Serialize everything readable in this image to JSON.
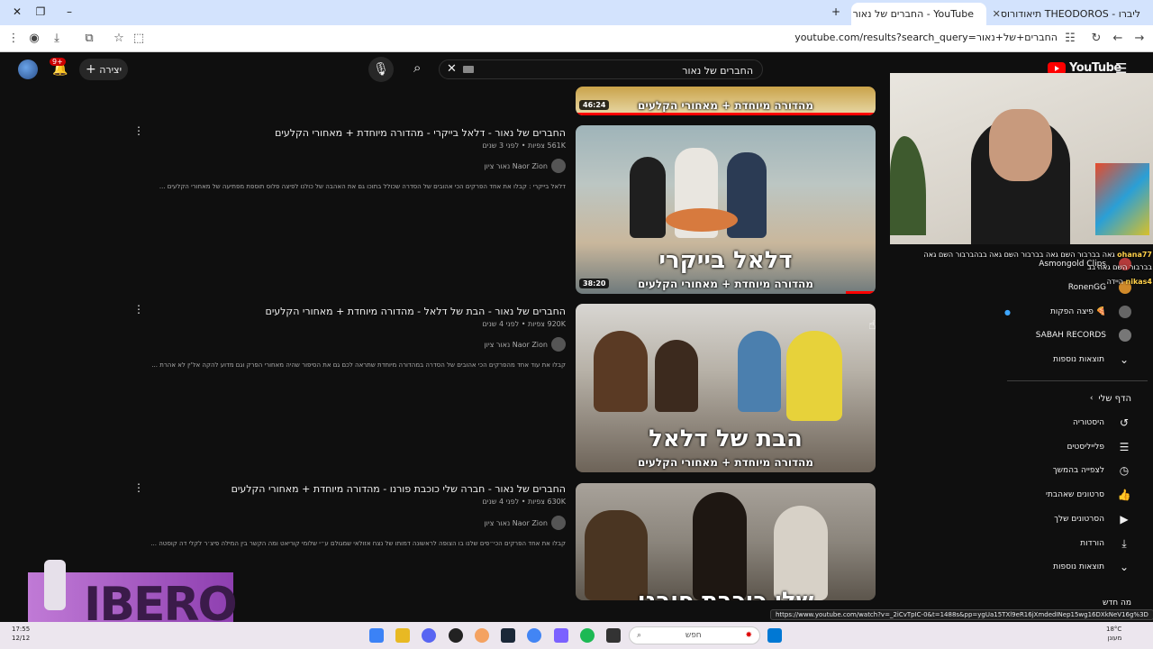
{
  "browser": {
    "tabs": [
      {
        "label": "YouTube - החברים של נאור (47)",
        "active": true
      },
      {
        "label": "ליברו - THEODOROS תיאודורוס",
        "active": false
      }
    ],
    "url": "youtube.com/results?search_query=החברים+של+נאור",
    "status_url": "https://www.youtube.com/watch?v=_2iCvTpIC-0&t=1488s&pp=ygUa15TXl9eR16jXmdedINep15wg16DXkNeV16g%3D"
  },
  "youtube": {
    "logo": "YouTube",
    "search_value": "החברים של נאור",
    "create_label": "יצירה",
    "notif_count": "9+",
    "results": [
      {
        "title": "החברים של נאור - דלאל בייקרי - מהדורה מיוחדת + מאחורי הקלעים",
        "meta": "561K צפיות • לפני 3 שנים",
        "channel": "נאור ציון Naor Zion",
        "desc": "דלאל בייקרי : קבלו את אחד הפרקים הכי אהובים של הסדרה שכולל בתוכו גם את האהבה של כולנו לפיצה פלוס תוספת מפתיעה של מאחורי הקלעים ...",
        "duration": "38:20",
        "thumb_big": "דלאל בייקרי",
        "thumb_small": "מהדורה מיוחדת + מאחורי הקלעים"
      },
      {
        "title": "החברים של נאור - הבת של דלאל - מהדורה מיוחדת + מאחורי הקלעים",
        "meta": "920K צפיות • לפני 4 שנים",
        "channel": "נאור ציון Naor Zion",
        "desc": "קבלו את עוד אחד מהפרקים הכי אהובים של הסדרה במהדורה מיוחדת שתראה לכם גם את הסיפור שהיה מאחורי הפרק וגם מדוע להקה אל'ין לא אהרת ...",
        "duration": "",
        "thumb_big": "הבת של דלאל",
        "thumb_small": "מהדורה מיוחדת + מאחורי הקלעים"
      },
      {
        "title": "החברים של נאור - חברה שלי כוכבת פורנו - מהדורה מיוחדת + מאחורי הקלעים",
        "meta": "630K צפיות • לפני 4 שנים",
        "channel": "נאור ציון Naor Zion",
        "desc": "קבלו את אחד הפרקים הכי״פים שלנו בו הצופה לראשונה דמותו של נצח אזולאי שמגולם ע״י שלומי קוריאט ומה הקשר בין המילה פיצ׳ר לקלי דה קוסטה ...",
        "duration": "",
        "thumb_big": "שלי כוכבת פורנו",
        "thumb_small": ""
      }
    ],
    "top_thumb": {
      "duration": "46:24",
      "small": "מהדורה מיוחדת + מאחורי הקלעים"
    },
    "sidebar": {
      "subs": [
        {
          "label": "Asmongold Clips",
          "color": "#b33a3a"
        },
        {
          "label": "RonenGG",
          "color": "#d08a2a"
        },
        {
          "label": "פיצה הפקות 🍕",
          "color": "#666666"
        },
        {
          "label": "SABAH RECORDS",
          "color": "#777777"
        }
      ],
      "more_subs": "תוצאות נוספות",
      "you_header": "הדף שלי",
      "you_items": [
        {
          "label": "היסטוריה",
          "icon": "history-icon",
          "glyph": "↺"
        },
        {
          "label": "פלייליסטים",
          "icon": "playlist-icon",
          "glyph": "☰"
        },
        {
          "label": "לצפייה בהמשך",
          "icon": "clock-icon",
          "glyph": "◷"
        },
        {
          "label": "סרטונים שאהבתי",
          "icon": "thumbs-up-icon",
          "glyph": "👍"
        },
        {
          "label": "הסרטונים שלך",
          "icon": "video-icon",
          "glyph": "▶"
        },
        {
          "label": "הורדות",
          "icon": "download-icon",
          "glyph": "⤓"
        }
      ],
      "more_you": "תוצאות נוספות",
      "next_header": "מה חדש"
    }
  },
  "chat": {
    "line1_user": "ohana77",
    "line1_text": "גאה בברבור השם גאה בברבור השם גאה בבהברבור השם גאה בברבור השם גאה בב",
    "line2_user": "nikas4",
    "line2_text": "היידה"
  },
  "overlay_logo": "IBERO",
  "taskbar": {
    "search_placeholder": "חפש",
    "time": "17:55",
    "date": "12/12",
    "temp": "18°C",
    "weather": "מעונן"
  }
}
